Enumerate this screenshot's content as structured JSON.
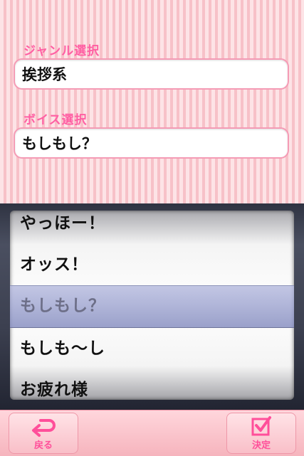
{
  "genre": {
    "label": "ジャンル選択",
    "value": "挨拶系"
  },
  "voice": {
    "label": "ボイス選択",
    "value": "もしもし？"
  },
  "picker": {
    "items": [
      "やっほー！",
      "オッス！",
      "もしもし？",
      "もしも〜し",
      "お疲れ様"
    ],
    "selected_index": 2
  },
  "toolbar": {
    "back_label": "戻る",
    "confirm_label": "決定"
  },
  "icons": {
    "back": "return-arrow-icon",
    "confirm": "checkbox-check-icon"
  },
  "colors": {
    "accent": "#ff5fa3",
    "field_border": "#f59bb5"
  }
}
